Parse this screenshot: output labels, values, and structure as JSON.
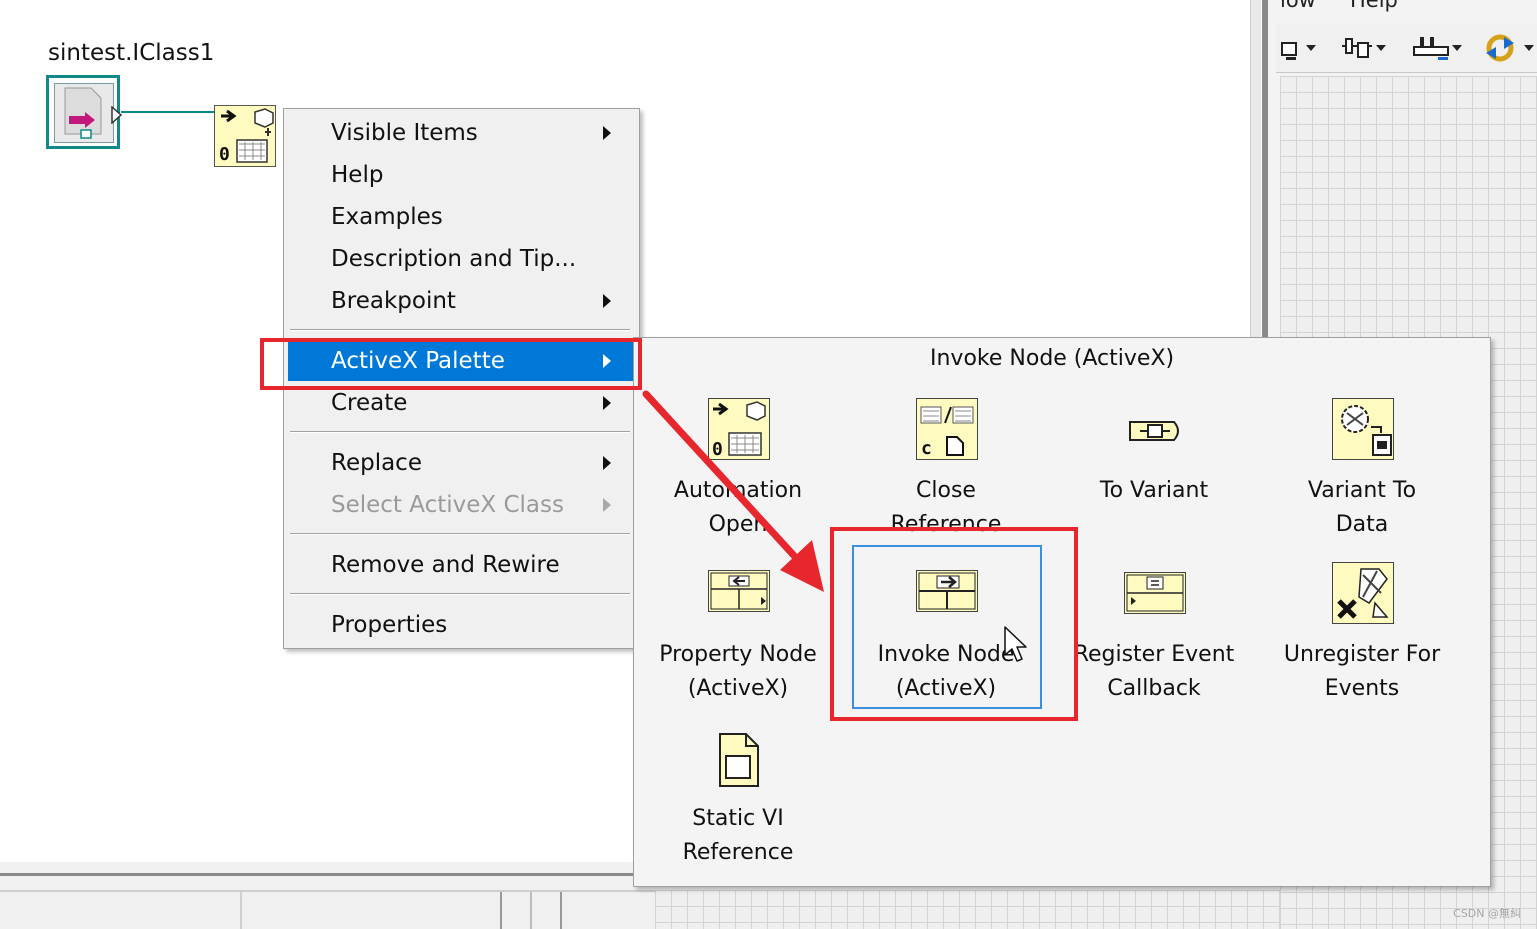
{
  "right_window": {
    "menu": [
      "low",
      "Help"
    ]
  },
  "diagram": {
    "class_label": "sintest.IClass1"
  },
  "context_menu": {
    "items": [
      {
        "label": "Visible Items",
        "submenu": true,
        "enabled": true
      },
      {
        "label": "Help",
        "submenu": false,
        "enabled": true
      },
      {
        "label": "Examples",
        "submenu": false,
        "enabled": true
      },
      {
        "label": "Description and Tip...",
        "submenu": false,
        "enabled": true
      },
      {
        "label": "Breakpoint",
        "submenu": true,
        "enabled": true
      },
      {
        "label": "ActiveX Palette",
        "submenu": true,
        "enabled": true,
        "selected": true
      },
      {
        "label": "Create",
        "submenu": true,
        "enabled": true
      },
      {
        "label": "Replace",
        "submenu": true,
        "enabled": true
      },
      {
        "label": "Select ActiveX Class",
        "submenu": true,
        "enabled": false
      },
      {
        "label": "Remove and Rewire",
        "submenu": false,
        "enabled": true
      },
      {
        "label": "Properties",
        "submenu": false,
        "enabled": true
      }
    ]
  },
  "palette": {
    "title": "Invoke Node (ActiveX)",
    "items": [
      {
        "label": "Automation\nOpen"
      },
      {
        "label": "Close\nReference"
      },
      {
        "label": "To Variant"
      },
      {
        "label": "Variant To\nData"
      },
      {
        "label": "Property Node\n(ActiveX)"
      },
      {
        "label": "Invoke Node\n(ActiveX)",
        "hovered": true
      },
      {
        "label": "Register Event\nCallback"
      },
      {
        "label": "Unregister For\nEvents"
      },
      {
        "label": "Static VI\nReference"
      }
    ]
  },
  "colors": {
    "selection": "#0078d7",
    "annotation": "#e8262e",
    "hover_border": "#3b8fe0",
    "node_fill": "#fffbc0",
    "refnum_border": "#0f8a8a"
  },
  "watermark": "CSDN @無糾"
}
